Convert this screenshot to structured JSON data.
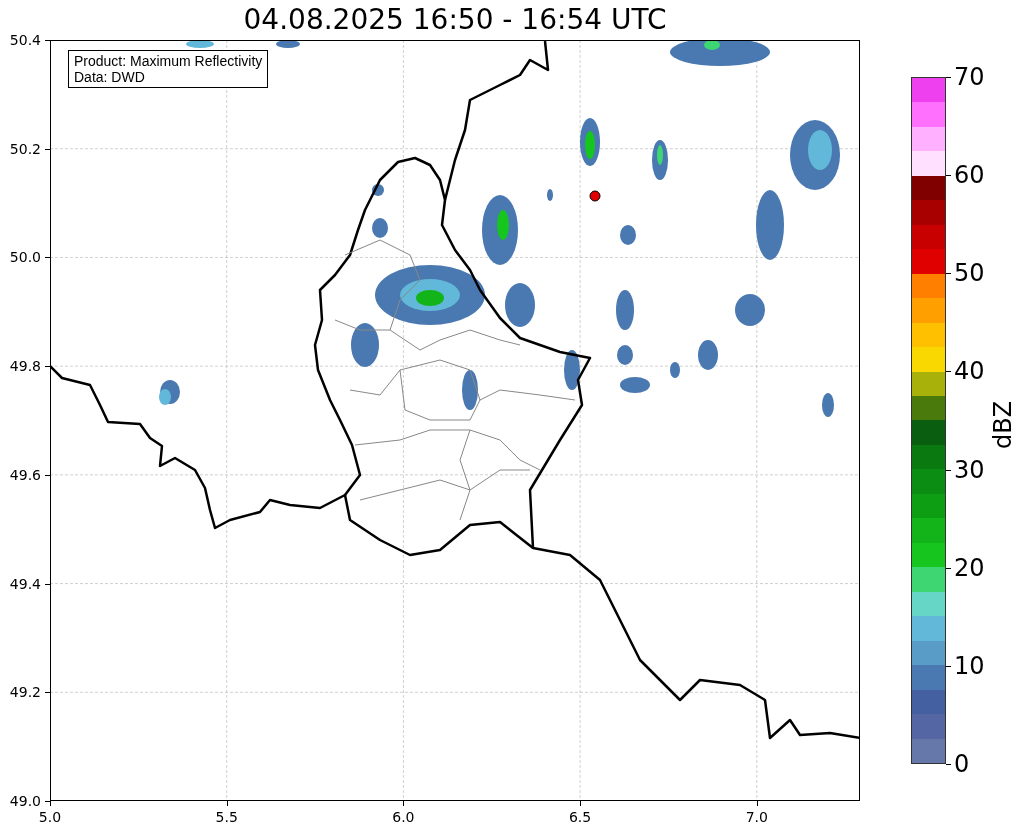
{
  "title": "04.08.2025 16:50 - 16:54 UTC",
  "info_box": [
    "Product: Maximum Reflectivity",
    "Data: DWD"
  ],
  "map": {
    "xticks": [
      "5.0",
      "5.5",
      "6.0",
      "6.5",
      "7.0"
    ],
    "yticks": [
      "50.4",
      "50.2",
      "50.0",
      "49.8",
      "49.6",
      "49.4",
      "49.2",
      "49.0"
    ]
  },
  "colorbar": {
    "label": "dBZ",
    "ticks": [
      "70",
      "60",
      "50",
      "40",
      "30",
      "20",
      "10",
      "0"
    ],
    "bins": [
      {
        "color": "#6677aa"
      },
      {
        "color": "#5566a5"
      },
      {
        "color": "#4460a0"
      },
      {
        "color": "#4a78b0"
      },
      {
        "color": "#5a9cc8"
      },
      {
        "color": "#62b8d8"
      },
      {
        "color": "#66d6c6"
      },
      {
        "color": "#3dd672"
      },
      {
        "color": "#16c51e"
      },
      {
        "color": "#12b41a"
      },
      {
        "color": "#0e9e14"
      },
      {
        "color": "#0b8c12"
      },
      {
        "color": "#0a7a10"
      },
      {
        "color": "#0a5e10"
      },
      {
        "color": "#4a7a0c"
      },
      {
        "color": "#a8b00a"
      },
      {
        "color": "#f8d800"
      },
      {
        "color": "#ffc000"
      },
      {
        "color": "#ffa000"
      },
      {
        "color": "#ff8000"
      },
      {
        "color": "#e00000"
      },
      {
        "color": "#c80000"
      },
      {
        "color": "#a80000"
      },
      {
        "color": "#800000"
      },
      {
        "color": "#ffe0ff"
      },
      {
        "color": "#ffb0ff"
      },
      {
        "color": "#ff70ff"
      },
      {
        "color": "#ee40ee"
      }
    ]
  }
}
